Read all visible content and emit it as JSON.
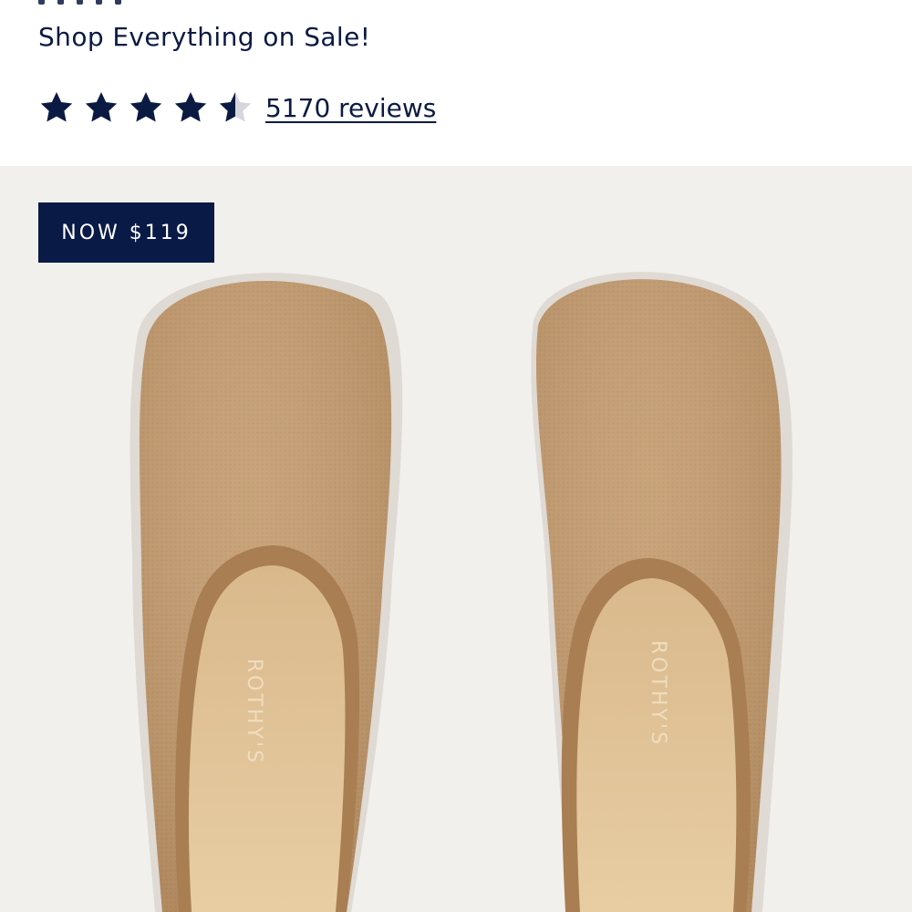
{
  "promo": {
    "text": "Shop Everything on Sale!"
  },
  "rating": {
    "value": 4.5,
    "max": 5,
    "reviews_label": "5170 reviews",
    "star_color": "#0b1a42"
  },
  "badge": {
    "label": "NOW $119",
    "background": "#0a1a47"
  },
  "product_image": {
    "brand_imprint": "ROTHY'S",
    "background": "#f2f0ed",
    "upper_color": "#c29a6e",
    "footbed_color": "#e2c49a"
  }
}
